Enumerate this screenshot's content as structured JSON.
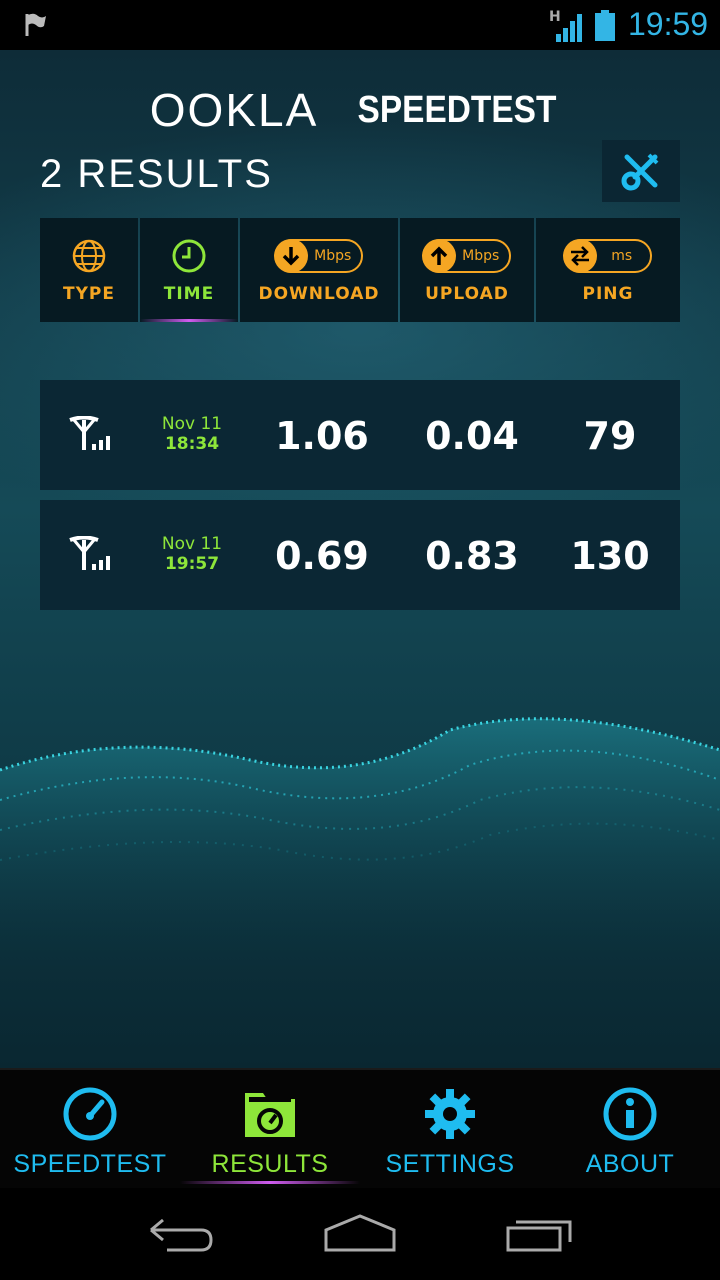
{
  "status_bar": {
    "time": "19:59",
    "network_type": "H",
    "icons": [
      "notification-flag-icon",
      "signal-icon",
      "battery-icon"
    ]
  },
  "app": {
    "logo_left": "OOKLA",
    "logo_right": "SPEEDTEST",
    "results_count": "2 RESULTS"
  },
  "columns": [
    {
      "label": "TYPE",
      "icon": "globe-icon"
    },
    {
      "label": "TIME",
      "icon": "clock-icon"
    },
    {
      "label": "DOWNLOAD",
      "icon": "download-arrow-icon",
      "unit": "Mbps"
    },
    {
      "label": "UPLOAD",
      "icon": "upload-arrow-icon",
      "unit": "Mbps"
    },
    {
      "label": "PING",
      "icon": "ping-arrows-icon",
      "unit": "ms"
    }
  ],
  "results": [
    {
      "type_icon": "cell-tower-icon",
      "date": "Nov 11",
      "time": "18:34",
      "download": "1.06",
      "upload": "0.04",
      "ping": "79"
    },
    {
      "type_icon": "cell-tower-icon",
      "date": "Nov 11",
      "time": "19:57",
      "download": "0.69",
      "upload": "0.83",
      "ping": "130"
    }
  ],
  "bottom_nav": [
    {
      "label": "SPEEDTEST",
      "icon": "speedometer-icon"
    },
    {
      "label": "RESULTS",
      "icon": "results-folder-icon",
      "active": true
    },
    {
      "label": "SETTINGS",
      "icon": "gear-icon"
    },
    {
      "label": "ABOUT",
      "icon": "info-icon"
    }
  ],
  "colors": {
    "accent_orange": "#f5a623",
    "accent_green": "#8ee63a",
    "accent_blue": "#1fbcf0",
    "active_glow": "#d05cf0"
  }
}
